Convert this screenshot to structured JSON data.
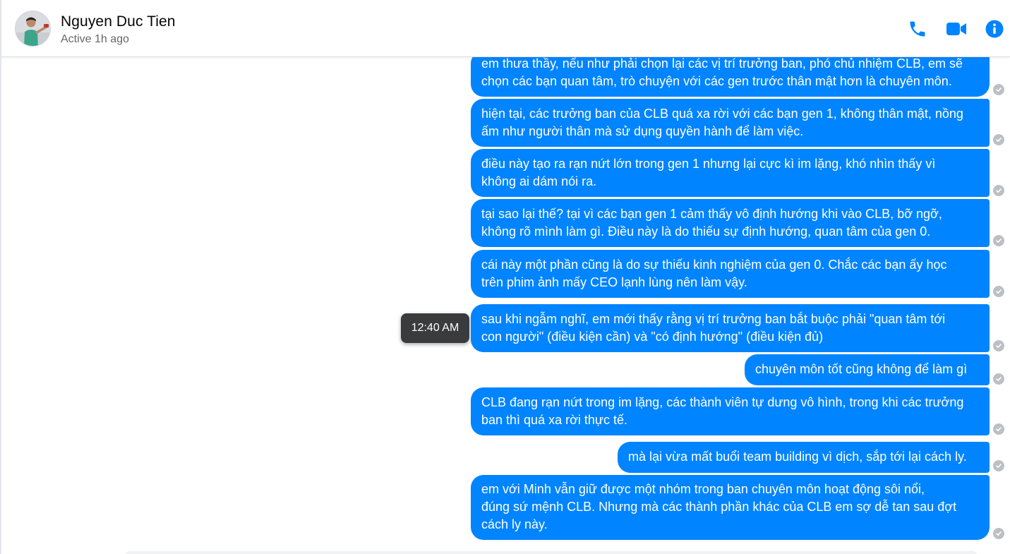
{
  "header": {
    "contact_name": "Nguyen Duc Tien",
    "status": "Active 1h ago",
    "icons": {
      "call": "phone-icon",
      "video": "video-camera-icon",
      "info": "info-icon"
    },
    "accent_color": "#0084ff"
  },
  "tooltip": {
    "time": "12:40 AM"
  },
  "messages": [
    {
      "text": "em thưa thầy, nếu như phải chọn lại các vị trí trưởng ban, phó chủ nhiệm CLB, em sẽ\nchọn các bạn quan tâm, trò chuyện với các gen trước thân mật hơn là chuyên môn."
    },
    {
      "text": "hiện tại, các trưởng ban của CLB quá xa rời với các bạn gen 1, không thân mật, nồng\nấm như người thân mà sử dụng quyền hành để làm việc."
    },
    {
      "text": "điều này tạo ra rạn nứt lớn trong gen 1 nhưng lại cực kì im lặng, khó nhìn thấy vì\nkhông ai dám nói ra."
    },
    {
      "text": "tại sao lại thế? tại vì các bạn gen 1 cảm thấy vô định hướng khi vào CLB, bỡ ngỡ,\nkhông rõ mình làm gì. Điều này là do thiếu sự định hướng, quan tâm của gen 0."
    },
    {
      "text": "cái này một phần cũng là do sự thiếu kinh nghiệm của gen 0. Chắc các bạn ấy học\ntrên phim ảnh mấy CEO lạnh lùng nên làm vậy."
    },
    {
      "text": "sau khi ngẫm nghĩ, em mới thấy rằng vị trí trưởng ban bắt buộc phải \"quan tâm tới\ncon người\" (điều kiện cần) và \"có định hướng\" (điều kiện đủ)"
    },
    {
      "text": "chuyên môn tốt cũng không để làm gì"
    },
    {
      "text": "CLB đang rạn nứt trong im lặng, các thành viên tự dưng vô hình, trong khi các trưởng\nban thì quá xa rời thực tế."
    },
    {
      "text": "mà lại vừa mất buổi team building vì dịch, sắp tới lại cách ly."
    },
    {
      "text": "em với Minh vẫn giữ được một nhóm trong ban chuyên môn hoạt động sôi nổi,\nđúng sứ mệnh CLB. Nhưng mà các thành phần khác của CLB em sợ dễ tan sau đợt\ncách ly này."
    }
  ],
  "seen_icon": "check-circle-icon"
}
